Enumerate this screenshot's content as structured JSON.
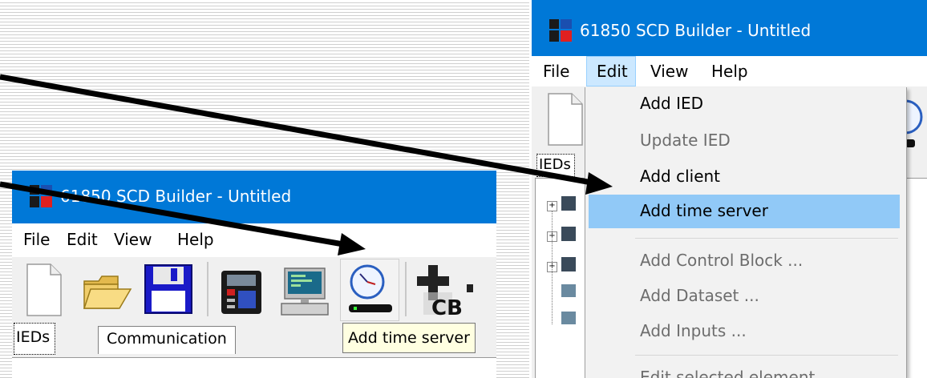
{
  "left_window": {
    "title": "61850 SCD Builder - Untitled",
    "menu": [
      "File",
      "Edit",
      "View",
      "Help"
    ],
    "toolbar_icons": [
      "new-file-icon",
      "open-folder-icon",
      "save-icon",
      "ied-icon",
      "client-computer-icon",
      "time-server-icon",
      "add-control-block-icon"
    ],
    "tabs": [
      "IEDs",
      "Communication"
    ],
    "tooltip": "Add time server"
  },
  "right_window": {
    "title": "61850 SCD Builder - Untitled",
    "menu": [
      "File",
      "Edit",
      "View",
      "Help"
    ],
    "tab_partial": "IEDs",
    "edit_menu": [
      {
        "label": "Add IED",
        "enabled": true
      },
      {
        "label": "Update IED",
        "enabled": false
      },
      {
        "label": "Add client",
        "enabled": true
      },
      {
        "label": "Add time server",
        "enabled": true,
        "highlighted": true
      },
      {
        "label": "Add Control Block ...",
        "enabled": false
      },
      {
        "label": "Add Dataset ...",
        "enabled": false
      },
      {
        "label": "Add Inputs ...",
        "enabled": false
      },
      {
        "label": "Edit selected element",
        "enabled": false
      }
    ]
  },
  "colors": {
    "title_bar": "#0078d7",
    "menu_highlight": "#91c9f7",
    "tooltip_bg": "#ffffe1",
    "arrow": "#000000"
  }
}
